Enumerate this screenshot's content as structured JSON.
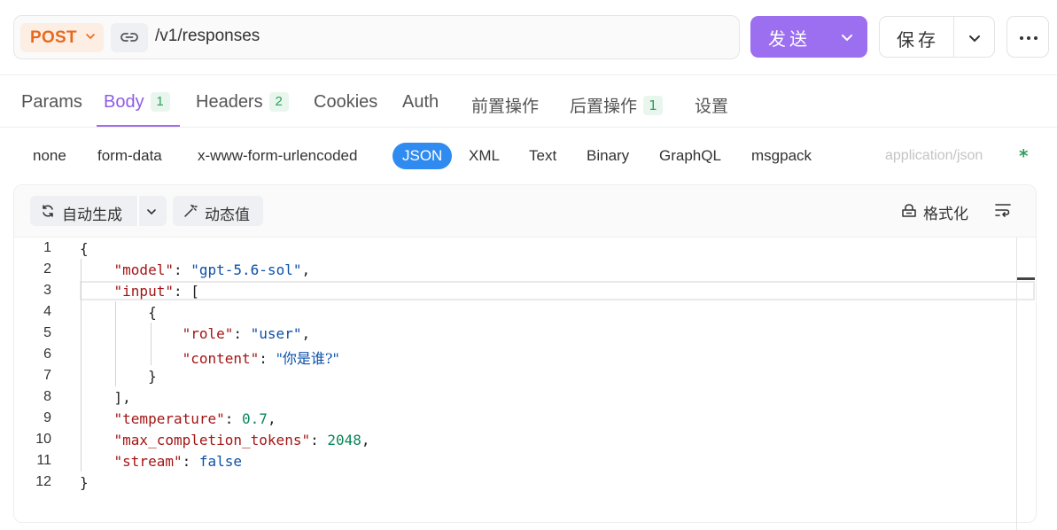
{
  "request": {
    "method": "POST",
    "url": "/v1/responses",
    "send_label": "发送",
    "save_label": "保存"
  },
  "tabs": [
    {
      "label": "Params",
      "badge": null
    },
    {
      "label": "Body",
      "badge": "1"
    },
    {
      "label": "Headers",
      "badge": "2"
    },
    {
      "label": "Cookies",
      "badge": null
    },
    {
      "label": "Auth",
      "badge": null
    },
    {
      "label": "前置操作",
      "badge": null
    },
    {
      "label": "后置操作",
      "badge": "1"
    },
    {
      "label": "设置",
      "badge": null
    }
  ],
  "active_tab": "Body",
  "body_types": [
    "none",
    "form-data",
    "x-www-form-urlencoded",
    "JSON",
    "XML",
    "Text",
    "Binary",
    "GraphQL",
    "msgpack"
  ],
  "active_body_type": "JSON",
  "content_type": "application/json",
  "required_mark": "*",
  "editor_toolbar": {
    "auto_generate": "自动生成",
    "dynamic_value": "动态值",
    "format": "格式化"
  },
  "line_numbers": [
    "1",
    "2",
    "3",
    "4",
    "5",
    "6",
    "7",
    "8",
    "9",
    "10",
    "11",
    "12"
  ],
  "code": {
    "model_key": "\"model\"",
    "model_val": "\"gpt-5.6-sol\"",
    "input_key": "\"input\"",
    "role_key": "\"role\"",
    "role_val": "\"user\"",
    "content_key": "\"content\"",
    "content_val": "\"你是谁?\"",
    "temperature_key": "\"temperature\"",
    "temperature_val": "0.7",
    "max_tokens_key": "\"max_completion_tokens\"",
    "max_tokens_val": "2048",
    "stream_key": "\"stream\"",
    "stream_val": "false"
  },
  "colors": {
    "accent": "#9c6ef0",
    "method": "#e8691e",
    "json_pill": "#2f8bf0",
    "badge_green": "#2ea05c"
  },
  "icons": [
    "link-icon",
    "chevron-down-icon",
    "more-dots-icon",
    "refresh-icon",
    "magic-wand-icon",
    "format-icon",
    "wrap-lines-icon"
  ]
}
